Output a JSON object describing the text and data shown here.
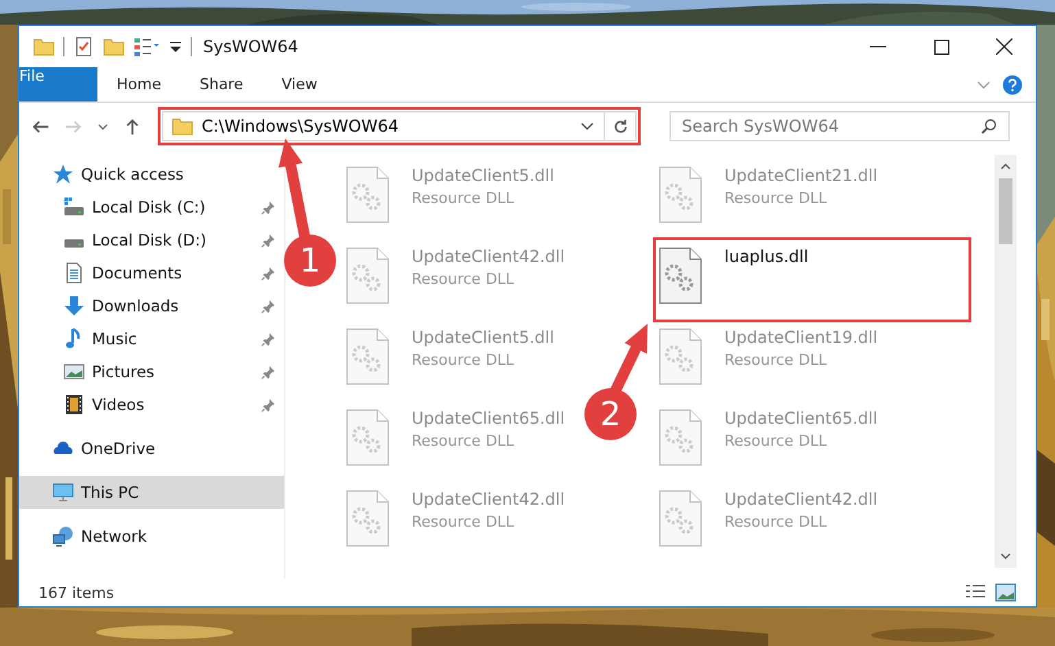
{
  "window": {
    "title": "SysWOW64"
  },
  "ribbon_tabs": [
    {
      "label": "File",
      "kind": "file"
    },
    {
      "label": "Home",
      "kind": "tab"
    },
    {
      "label": "Share",
      "kind": "tab"
    },
    {
      "label": "View",
      "kind": "tab"
    }
  ],
  "address_bar": {
    "path": "C:\\Windows\\SysWOW64"
  },
  "search": {
    "placeholder": "Search SysWOW64"
  },
  "sidebar": {
    "items": [
      {
        "label": "Quick access",
        "kind": "star",
        "selected": false,
        "children": [
          {
            "label": "Local Disk (C:)",
            "kind": "sysdrive",
            "pinned": true
          },
          {
            "label": "Local Disk (D:)",
            "kind": "drive",
            "pinned": true
          },
          {
            "label": "Documents",
            "kind": "documents",
            "pinned": true
          },
          {
            "label": "Downloads",
            "kind": "downloads",
            "pinned": true
          },
          {
            "label": "Music",
            "kind": "music",
            "pinned": true
          },
          {
            "label": "Pictures",
            "kind": "pictures",
            "pinned": true
          },
          {
            "label": "Videos",
            "kind": "videos",
            "pinned": true
          }
        ]
      },
      {
        "label": "OneDrive",
        "kind": "cloud",
        "selected": false
      },
      {
        "label": "This PC",
        "kind": "pc",
        "selected": true
      },
      {
        "label": "Network",
        "kind": "network",
        "selected": false
      }
    ]
  },
  "files": [
    {
      "name": "UpdateClient5.dll",
      "type": "Resource DLL",
      "blurred": true
    },
    {
      "name": "UpdateClient21.dll",
      "type": "Resource DLL",
      "blurred": true
    },
    {
      "name": "UpdateClient42.dll",
      "type": "Resource DLL",
      "blurred": true
    },
    {
      "name": "luaplus.dll",
      "blurred": false
    },
    {
      "name": "UpdateClient5.dll",
      "type": "Resource DLL",
      "blurred": true
    },
    {
      "name": "UpdateClient19.dll",
      "type": "Resource DLL",
      "blurred": true
    },
    {
      "name": "UpdateClient65.dll",
      "type": "Resource DLL",
      "blurred": true
    },
    {
      "name": "UpdateClient65.dll",
      "type": "Resource DLL",
      "blurred": true
    },
    {
      "name": "UpdateClient42.dll",
      "type": "Resource DLL",
      "blurred": true
    },
    {
      "name": "UpdateClient42.dll",
      "type": "Resource DLL",
      "blurred": true
    }
  ],
  "status_bar": {
    "item_count": "167 items"
  },
  "annotations": [
    {
      "number": "1"
    },
    {
      "number": "2"
    }
  ]
}
